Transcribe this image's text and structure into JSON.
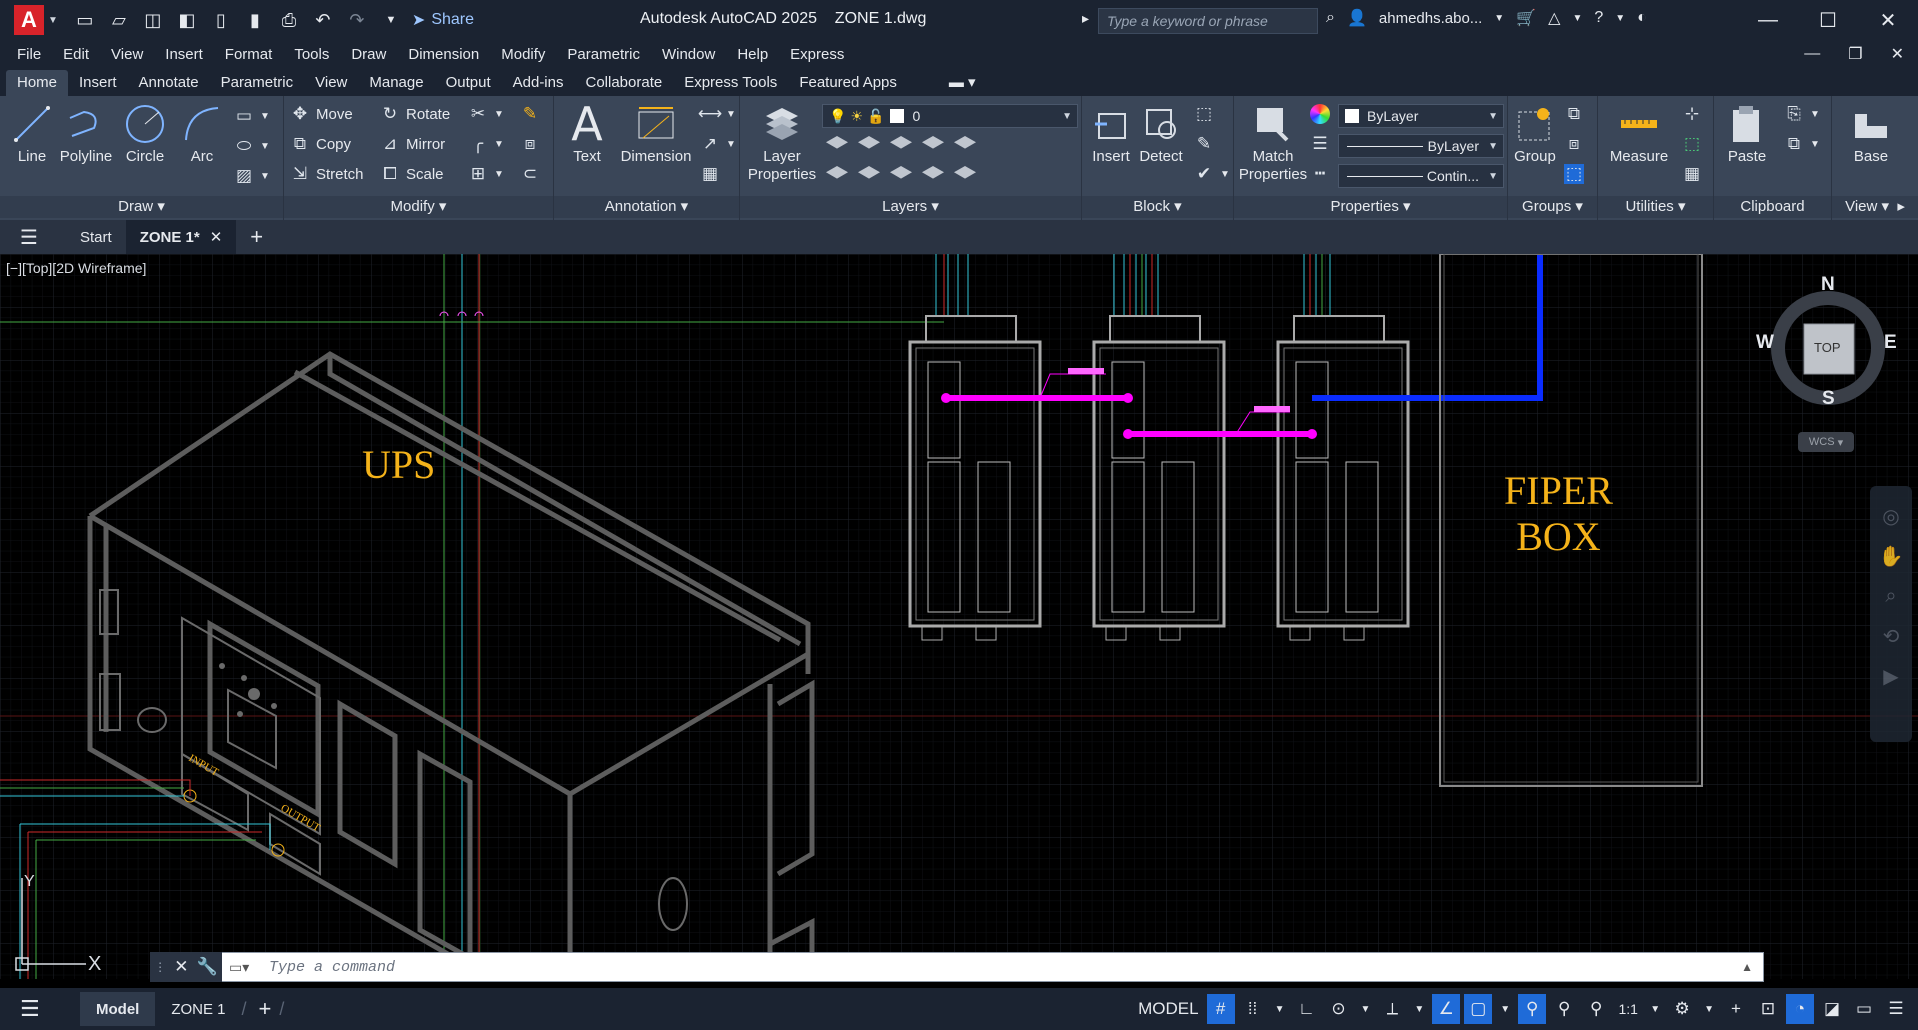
{
  "titlebar": {
    "app_title": "Autodesk AutoCAD 2025",
    "file_title": "ZONE 1.dwg",
    "share_label": "Share",
    "search_placeholder": "Type a keyword or phrase",
    "user_name": "ahmedhs.abo..."
  },
  "menubar": {
    "items": [
      "File",
      "Edit",
      "View",
      "Insert",
      "Format",
      "Tools",
      "Draw",
      "Dimension",
      "Modify",
      "Parametric",
      "Window",
      "Help",
      "Express"
    ]
  },
  "ribbon_tabs": {
    "items": [
      "Home",
      "Insert",
      "Annotate",
      "Parametric",
      "View",
      "Manage",
      "Output",
      "Add-ins",
      "Collaborate",
      "Express Tools",
      "Featured Apps"
    ],
    "active": "Home"
  },
  "ribbon": {
    "draw": {
      "title": "Draw",
      "line": "Line",
      "polyline": "Polyline",
      "circle": "Circle",
      "arc": "Arc"
    },
    "modify": {
      "title": "Modify",
      "move": "Move",
      "rotate": "Rotate",
      "copy": "Copy",
      "mirror": "Mirror",
      "stretch": "Stretch",
      "scale": "Scale"
    },
    "annotation": {
      "title": "Annotation",
      "text": "Text",
      "dimension": "Dimension"
    },
    "layers": {
      "title": "Layers",
      "layer_properties_1": "Layer",
      "layer_properties_2": "Properties",
      "current_layer": "0"
    },
    "block": {
      "title": "Block",
      "insert": "Insert",
      "detect": "Detect"
    },
    "properties": {
      "title": "Properties",
      "match_1": "Match",
      "match_2": "Properties",
      "color": "ByLayer",
      "lineweight": "ByLayer",
      "linetype": "Contin..."
    },
    "groups": {
      "title": "Groups",
      "group": "Group"
    },
    "utilities": {
      "title": "Utilities",
      "measure": "Measure"
    },
    "clipboard": {
      "title": "Clipboard",
      "paste": "Paste"
    },
    "view": {
      "title": "View",
      "base": "Base"
    }
  },
  "file_tabs": {
    "start": "Start",
    "active": "ZONE 1*"
  },
  "canvas": {
    "viewport_label": "[−][Top][2D Wireframe]",
    "ups_label": "UPS",
    "fiber_box_line1": "FIPER",
    "fiber_box_line2": "BOX",
    "input_label": "INPUT",
    "output_label": "OUTPUT",
    "viewcube": {
      "north": "N",
      "south": "S",
      "east": "E",
      "west": "W",
      "face": "TOP",
      "wcs": "WCS"
    },
    "ucs": {
      "x": "X",
      "y": "Y"
    }
  },
  "command": {
    "placeholder": "Type a command"
  },
  "statusbar": {
    "model_tab": "Model",
    "layout_tab": "ZONE 1",
    "model_label": "MODEL",
    "scale": "1:1"
  },
  "colors": {
    "magenta_link": "#ff00ff",
    "blue_link": "#0000ff",
    "cad_text": "#f5b31a",
    "accent": "#1f6bd8"
  }
}
